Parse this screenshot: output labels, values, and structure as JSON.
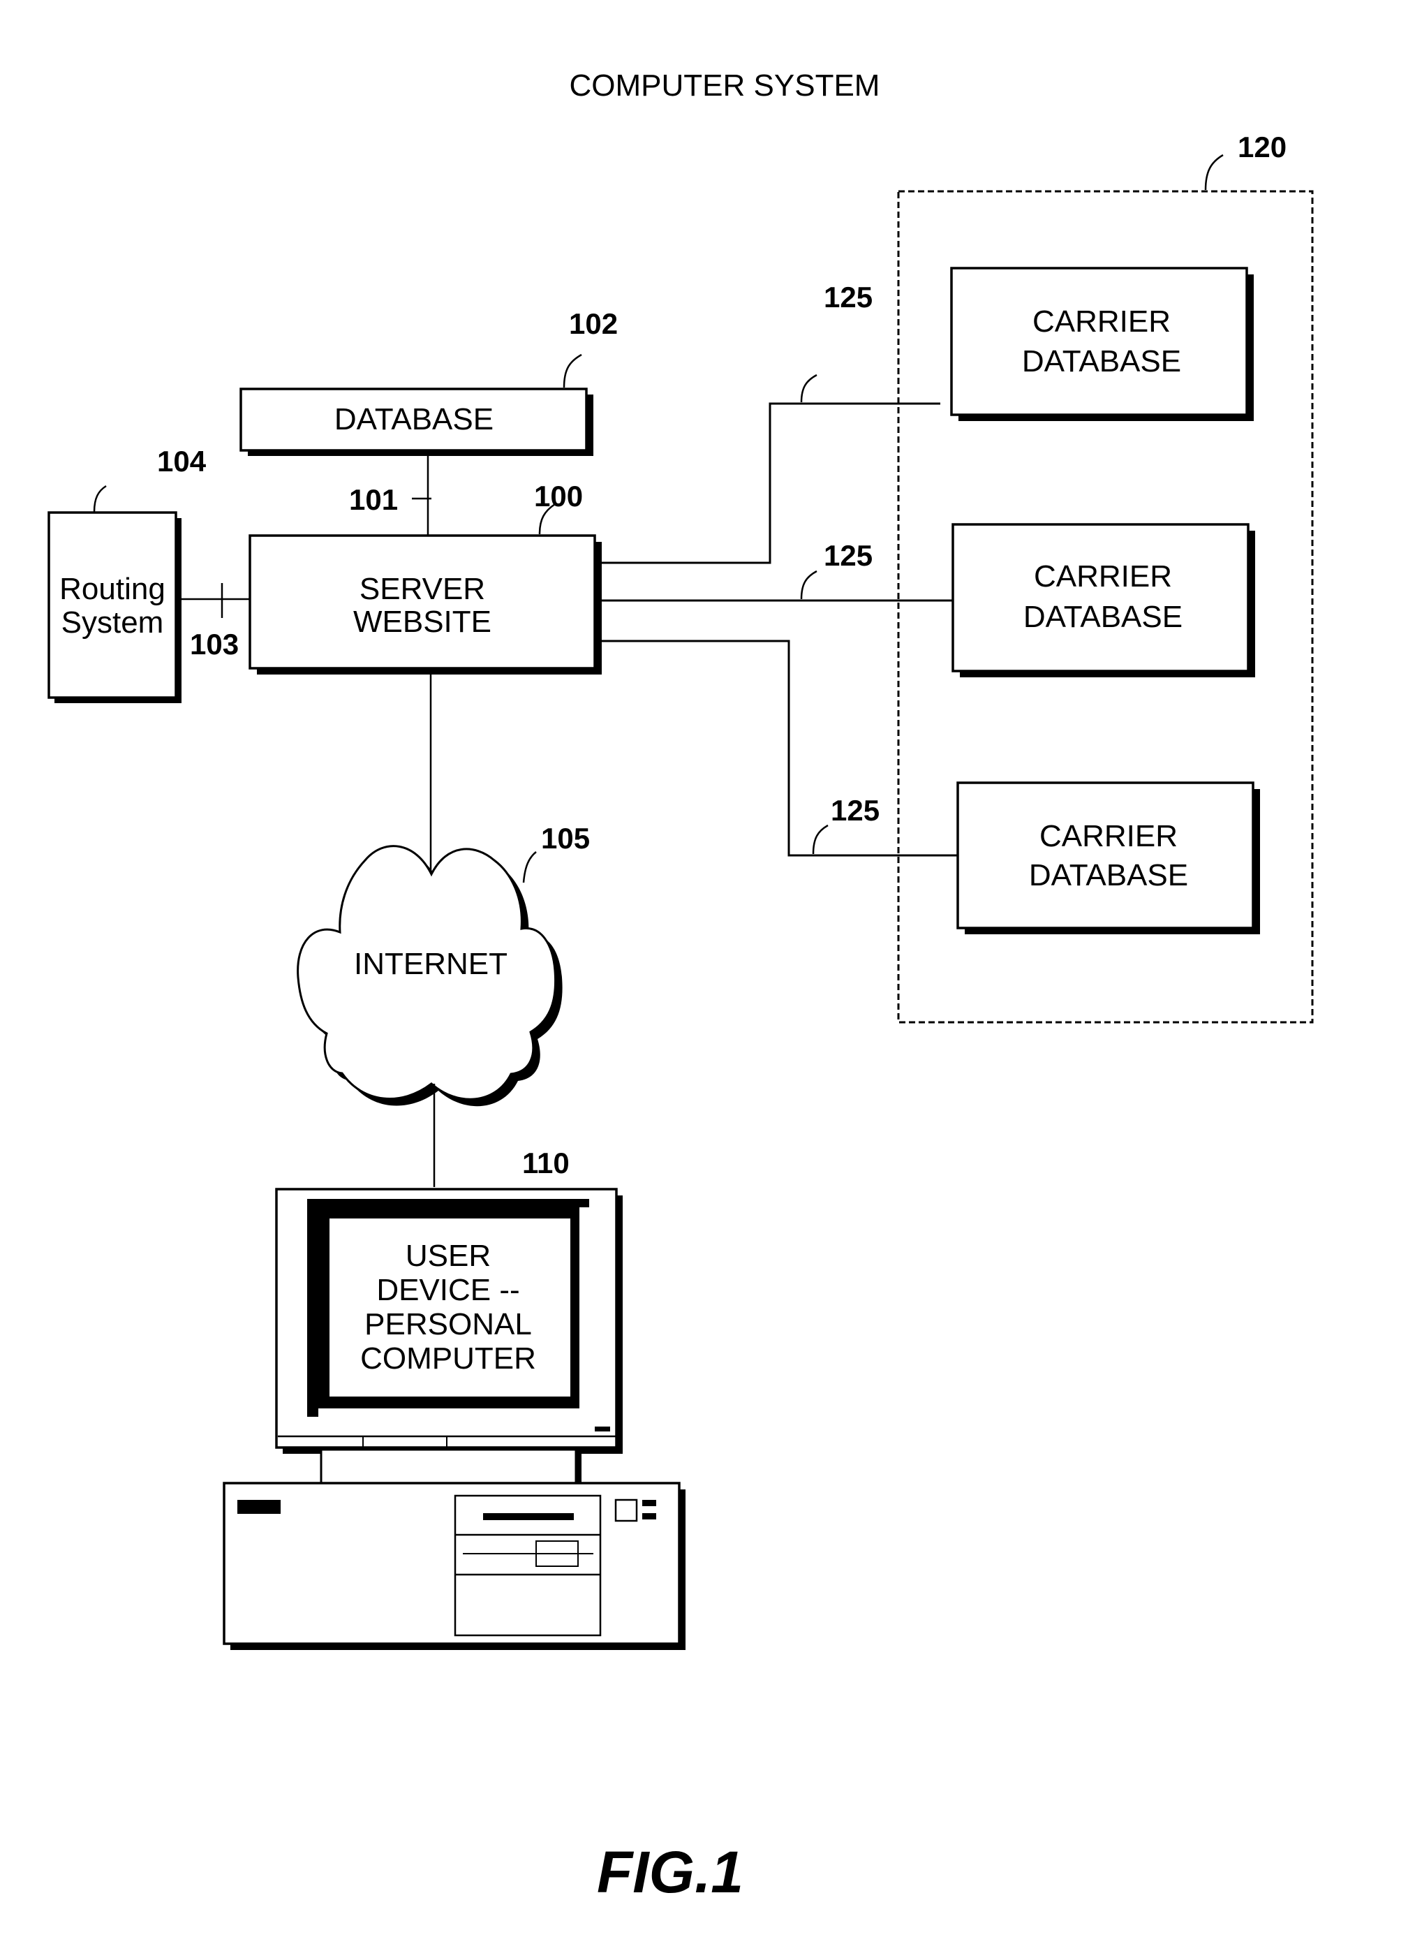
{
  "title": "COMPUTER SYSTEM",
  "figure_label": "FIG.1",
  "nodes": {
    "database": {
      "ref": "102",
      "lines": [
        "DATABASE"
      ]
    },
    "server": {
      "ref": "100",
      "lines": [
        "SERVER",
        "WEBSITE"
      ]
    },
    "routing": {
      "ref": "104",
      "lines": [
        "Routing",
        "System"
      ]
    },
    "internet": {
      "ref": "105",
      "lines": [
        "INTERNET"
      ]
    },
    "user_device": {
      "ref": "110",
      "lines": [
        "USER",
        "DEVICE --",
        "PERSONAL",
        "COMPUTER"
      ]
    },
    "carrier_group": {
      "ref": "120"
    },
    "carriers": [
      {
        "lines": [
          "CARRIER",
          "DATABASE"
        ]
      },
      {
        "lines": [
          "CARRIER",
          "DATABASE"
        ]
      },
      {
        "lines": [
          "CARRIER",
          "DATABASE"
        ]
      }
    ]
  },
  "connections": {
    "db_server": {
      "ref": "101"
    },
    "routing_server": {
      "ref": "103"
    },
    "carrier_links": [
      {
        "ref": "125"
      },
      {
        "ref": "125"
      },
      {
        "ref": "125"
      }
    ]
  }
}
